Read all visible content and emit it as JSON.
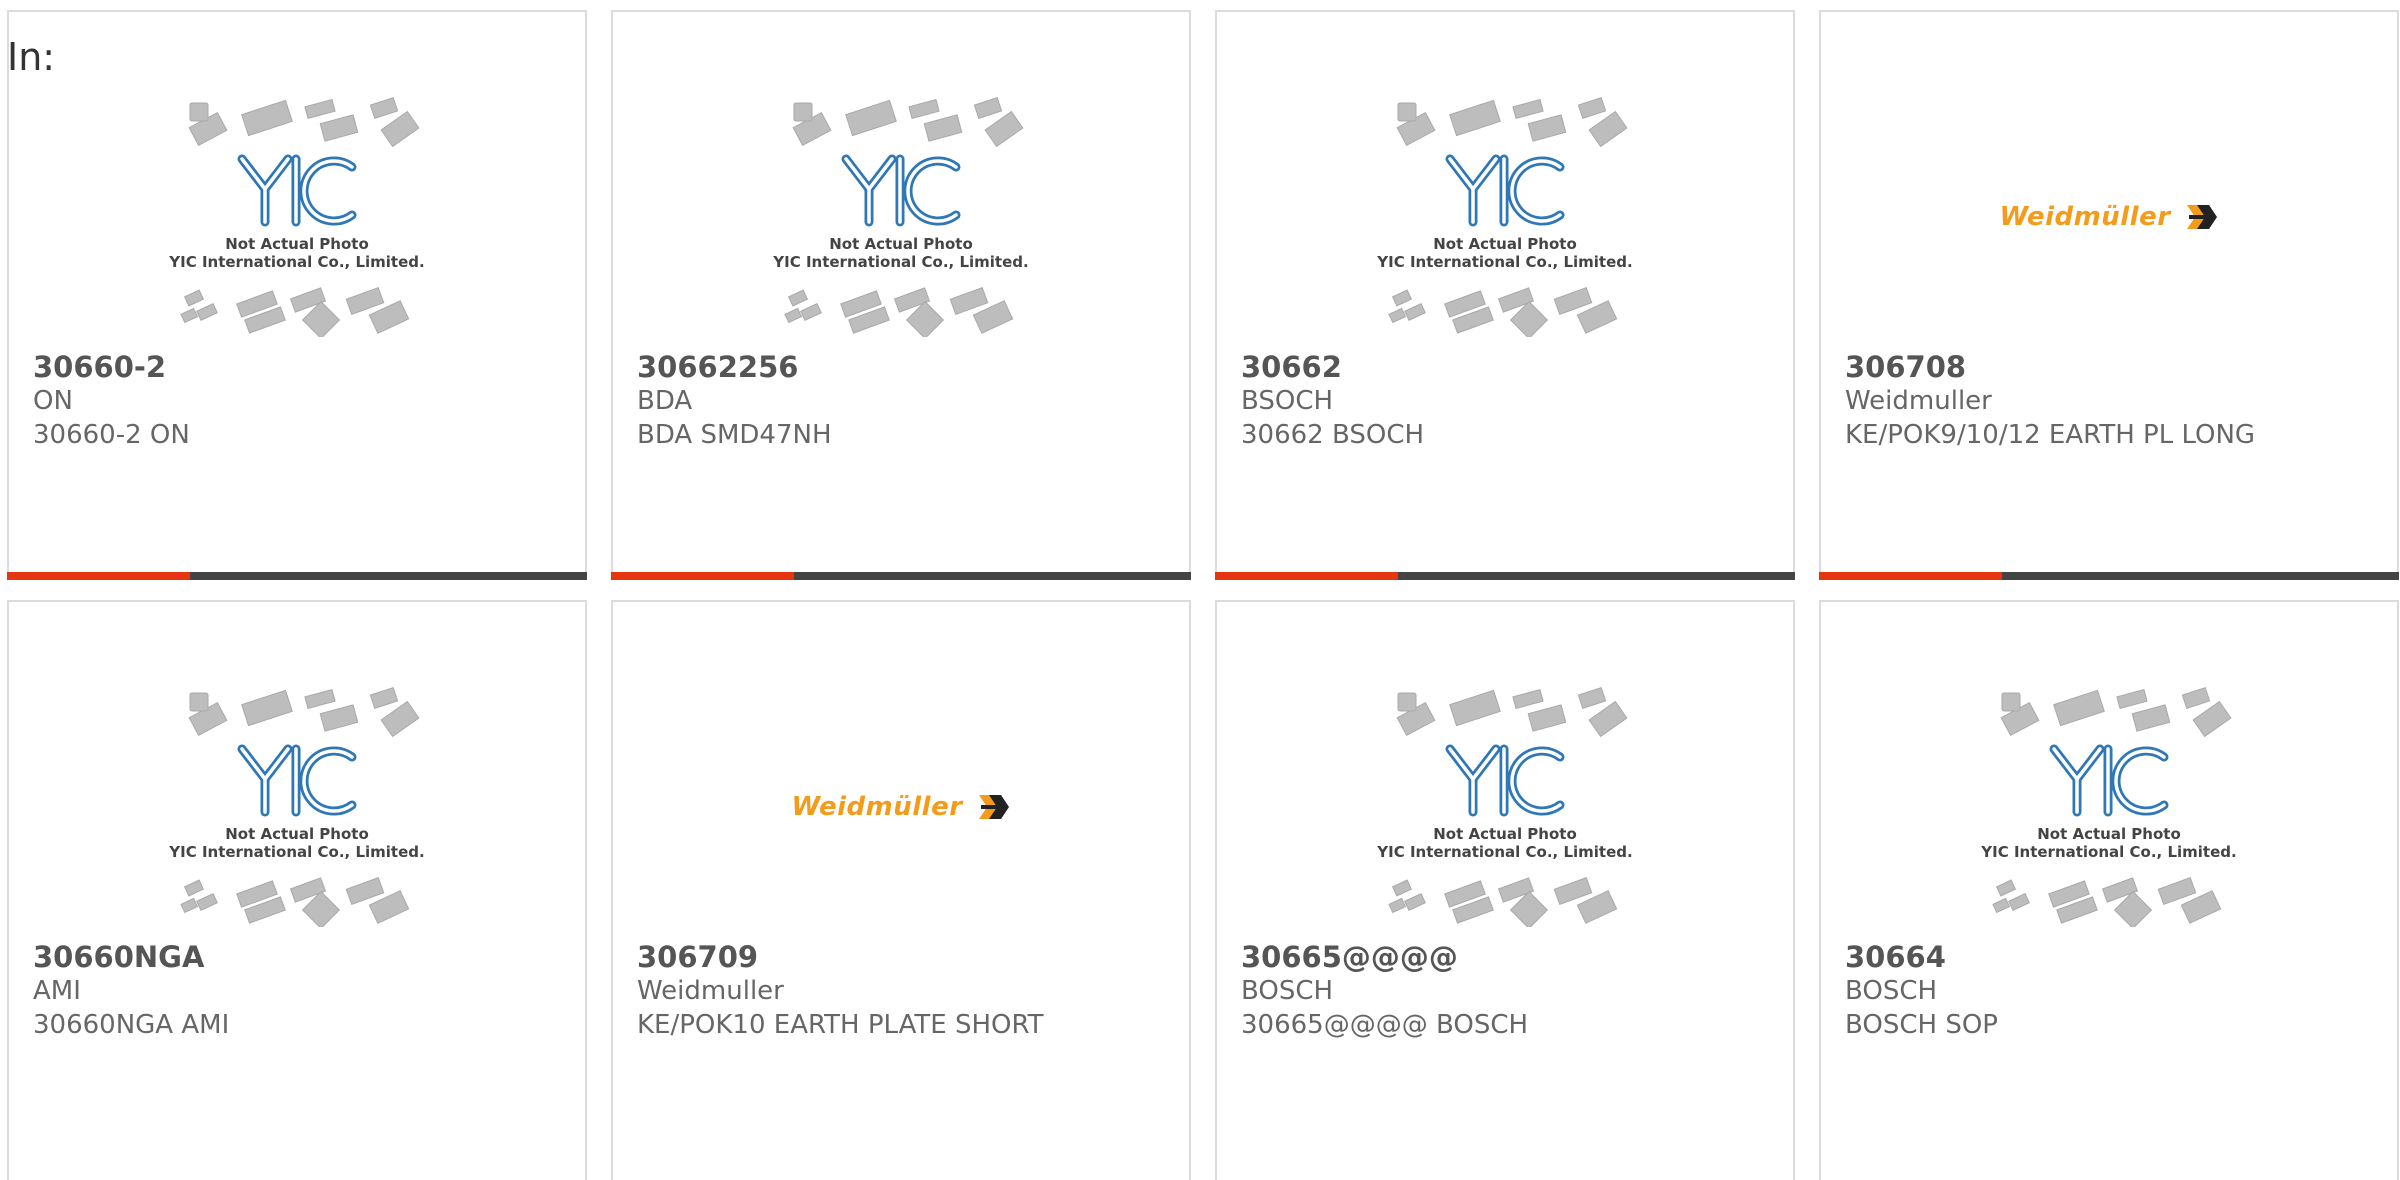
{
  "header": {
    "in_label": "In:"
  },
  "placeholder": {
    "brand": "YIC",
    "caption_line1": "Not Actual Photo",
    "caption_line2": "YIC International Co., Limited."
  },
  "logo_wm": {
    "text": "Weidmüller"
  },
  "colors": {
    "accent": "#e53511",
    "bar": "#444444",
    "brand_blue": "#2f77b5",
    "weidmuller_orange": "#f39c1c"
  },
  "products": [
    {
      "part": "30660-2",
      "mfr": "ON",
      "desc": "30660-2 ON",
      "image": "yic-placeholder"
    },
    {
      "part": "30662256",
      "mfr": "BDA",
      "desc": "BDA SMD47NH",
      "image": "yic-placeholder"
    },
    {
      "part": "30662",
      "mfr": "BSOCH",
      "desc": "30662 BSOCH",
      "image": "yic-placeholder"
    },
    {
      "part": "306708",
      "mfr": "Weidmuller",
      "desc": "KE/POK9/10/12 EARTH PL LONG",
      "image": "weidmuller-logo"
    },
    {
      "part": "30660NGA",
      "mfr": "AMI",
      "desc": "30660NGA AMI",
      "image": "yic-placeholder"
    },
    {
      "part": "306709",
      "mfr": "Weidmuller",
      "desc": "KE/POK10 EARTH PLATE SHORT",
      "image": "weidmuller-logo"
    },
    {
      "part": "30665@@@@",
      "mfr": "BOSCH",
      "desc": "30665@@@@ BOSCH",
      "image": "yic-placeholder"
    },
    {
      "part": "30664",
      "mfr": "BOSCH",
      "desc": "BOSCH SOP",
      "image": "yic-placeholder"
    }
  ]
}
